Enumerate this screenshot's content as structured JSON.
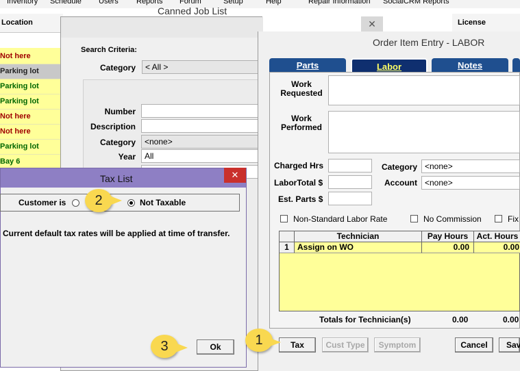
{
  "menu": [
    "Inventory",
    "Schedule",
    "Users",
    "Reports",
    "Forum",
    "Setup",
    "Help",
    "Repair Information",
    "SocialCRM Reports"
  ],
  "back_grid": {
    "location_header": "Location",
    "license_header": "License",
    "rows": [
      {
        "text": "Not here",
        "style": "red"
      },
      {
        "text": "Parking lot",
        "style": "sel"
      },
      {
        "text": "Parking lot",
        "style": "green"
      },
      {
        "text": "Parking lot",
        "style": "green"
      },
      {
        "text": "Not here",
        "style": "red"
      },
      {
        "text": "Not here",
        "style": "red"
      },
      {
        "text": "Parking lot",
        "style": "green"
      },
      {
        "text": "Bay 6",
        "style": "green"
      }
    ]
  },
  "canned": {
    "title": "Canned Job List",
    "criteria_label": "Search Criteria:",
    "category_label": "Category",
    "category_value": "< All >",
    "number_label": "Number",
    "description_label": "Description",
    "category2_label": "Category",
    "category2_value": "<none>",
    "year_label": "Year",
    "year_value": "All"
  },
  "order": {
    "title": "Order Item Entry - LABOR",
    "tabs": [
      "Parts",
      "Labor",
      "Notes"
    ],
    "work_requested_label": "Work Requested",
    "work_performed_label": "Work Performed",
    "charged_hrs_label": "Charged Hrs",
    "labor_total_label": "LaborTotal $",
    "est_parts_label": "Est. Parts $",
    "category_label": "Category",
    "category_value": "<none>",
    "account_label": "Account",
    "account_value": "<none>",
    "non_standard_label": "Non-Standard Labor Rate",
    "no_commission_label": "No Commission",
    "fixed_label": "Fix",
    "grid_headers": [
      "Technician",
      "Pay Hours",
      "Act. Hours"
    ],
    "grid_rows": [
      {
        "num": "1",
        "technician": "Assign on WO",
        "pay": "0.00",
        "act": "0.00"
      }
    ],
    "totals_label": "Totals for Technician(s)",
    "totals_pay": "0.00",
    "totals_act": "0.00",
    "btn_tax": "Tax",
    "btn_cust_type": "Cust Type",
    "btn_symptom": "Symptom",
    "btn_cancel": "Cancel",
    "btn_save": "Sav"
  },
  "tax": {
    "title": "Tax List",
    "customer_is_label": "Customer is",
    "not_taxable_label": "Not Taxable",
    "message": "Current default tax rates will be applied at time of transfer.",
    "ok_label": "Ok",
    "close_glyph": "✕"
  },
  "callouts": {
    "one": "1",
    "two": "2",
    "three": "3"
  },
  "colors": {
    "tab_blue": "#1f4f8f",
    "grid_yellow": "#ffff99",
    "tax_title": "#8e7fc4",
    "close_red": "#c9302c",
    "callout": "#f9d850"
  }
}
